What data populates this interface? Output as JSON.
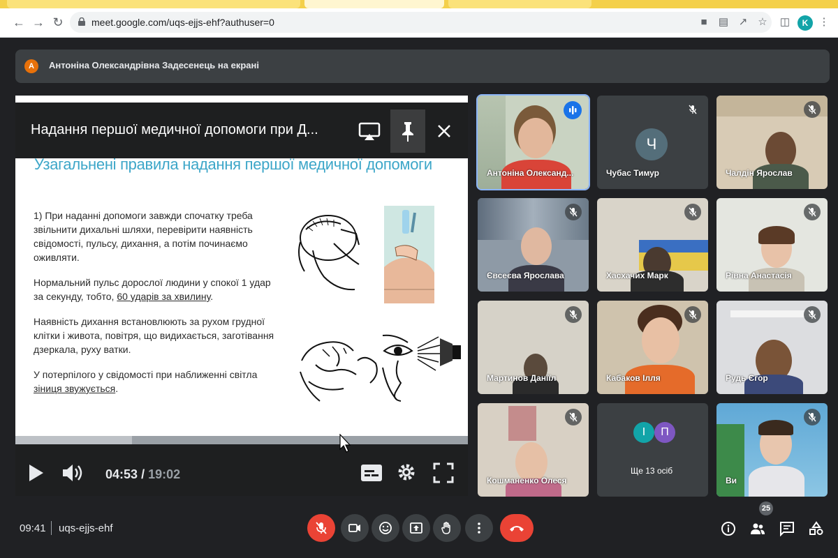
{
  "browser": {
    "url": "meet.google.com/uqs-ejjs-ehf?authuser=0",
    "profile_initial": "K"
  },
  "banner": {
    "avatar_initial": "А",
    "text": "Антоніна Олександрівна Задесенець на екрані"
  },
  "presentation": {
    "title": "Надання першої медичної допомоги при Д...",
    "slide_title": "Узагальнені правила надання першої медичної допомоги",
    "paragraphs": [
      "1) При наданні допомоги завжди спочатку треба звільнити дихальні шляхи, перевірити наявність свідомості, пульсу, дихання, а потім починаємо оживляти.",
      "Нормальний пульс дорослої людини у спокої 1 удар за секунду, тобто,",
      "Наявність дихання встановлюють за рухом грудної клітки і живота, повітря, що видихається, заготівання дзеркала, руху ватки.",
      "У потерпілого у свідомості при наближенні світла"
    ],
    "paragraph2_underlined": "60 ударів за хвилину",
    "paragraph2_end": ".",
    "paragraph4_underlined": "зіниця звужується",
    "paragraph4_end": ".",
    "time_current": "04:53",
    "time_separator": "/",
    "time_total": "19:02",
    "progress_fraction": 0.257
  },
  "participants": [
    {
      "name": "Антоніна Олександ...",
      "speaking": true
    },
    {
      "name": "Чубас Тимур",
      "initial": "Ч",
      "muted": true
    },
    {
      "name": "Чалдін Ярослав",
      "muted": true
    },
    {
      "name": "Євсеєва Ярослава",
      "muted": true
    },
    {
      "name": "Хасхачих Марк",
      "muted": true
    },
    {
      "name": "Рівна Анастасія",
      "muted": true
    },
    {
      "name": "Мартинов Даніїл",
      "muted": true
    },
    {
      "name": "Кабаков Ілля",
      "muted": true
    },
    {
      "name": "Рудь Єгор",
      "muted": true
    },
    {
      "name": "Кошманенко Олеся",
      "muted": true
    },
    {
      "name": "Ще 13 осіб",
      "initials": [
        "І",
        "П"
      ]
    },
    {
      "name": "Ви",
      "muted": true
    }
  ],
  "bottom_bar": {
    "time": "09:41",
    "meeting_code": "uqs-ejjs-ehf",
    "participants_count": "25"
  },
  "colors": {
    "background": "#202124",
    "tile": "#3c4043",
    "red": "#ea4335",
    "accent_blue": "#1a73e8",
    "slide_title": "#3ca6c8"
  }
}
